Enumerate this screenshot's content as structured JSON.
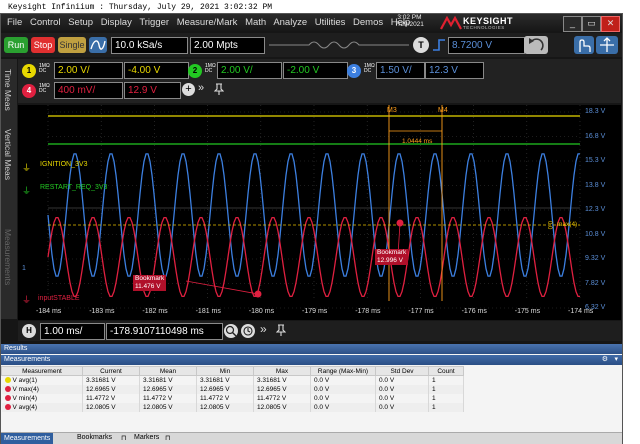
{
  "caption": "Keysight Infiniium : Thursday, July 29, 2021 3:02:32 PM",
  "menu": [
    "File",
    "Control",
    "Setup",
    "Display",
    "Trigger",
    "Measure/Mark",
    "Math",
    "Analyze",
    "Utilities",
    "Demos",
    "Help"
  ],
  "clock": {
    "time": "3:02 PM",
    "date": "7/29/2021"
  },
  "brand": {
    "name": "KEYSIGHT",
    "sub": "TECHNOLOGIES"
  },
  "toolbar": {
    "run": "Run",
    "stop": "Stop",
    "single": "Single",
    "sample_rate": "10.0 kSa/s",
    "memory_depth": "2.00 Mpts",
    "trigger_badge": "T",
    "trigger_level": "8.7200 V"
  },
  "vtabs": {
    "time_meas": "Time Meas",
    "vertical_meas": "Vertical Meas",
    "measurements": "Measurements"
  },
  "channels": {
    "ch1": {
      "num": "1",
      "coupling": "1MΩ",
      "mode": "DC",
      "scale": "2.00 V/",
      "offset": "-4.00 V"
    },
    "ch2": {
      "num": "2",
      "coupling": "1MΩ",
      "mode": "DC",
      "scale": "2.00 V/",
      "offset": "-2.00 V"
    },
    "ch3": {
      "num": "3",
      "coupling": "1MΩ",
      "mode": "DC",
      "scale": "1.50 V/",
      "offset": "12.3 V"
    },
    "ch4": {
      "num": "4",
      "coupling": "1MΩ",
      "mode": "DC",
      "scale": "400 mV/",
      "offset": "12.9 V"
    }
  },
  "labels": {
    "ignition": "IGNITION_3V3",
    "restart": "RESTART_REQ_3V3",
    "input": "inputSTABLE",
    "ground_marker": "1",
    "max_tag": "max(4)",
    "ref_marker": "0.0"
  },
  "markers": {
    "m3": "M3",
    "m4": "M4",
    "delta": "1.0444 ms"
  },
  "bookmarks": [
    {
      "title": "Bookmark",
      "value": "11.476 V"
    },
    {
      "title": "Bookmark",
      "value": "12.996 V"
    }
  ],
  "x_ticks": [
    "-184 ms",
    "-183 ms",
    "-182 ms",
    "-181 ms",
    "-180 ms",
    "-179 ms",
    "-178 ms",
    "-177 ms",
    "-176 ms",
    "-175 ms",
    "-174 ms"
  ],
  "y_ticks": [
    "18.3 V",
    "16.8 V",
    "15.3 V",
    "13.8 V",
    "12.3 V",
    "10.8 V",
    "9.32 V",
    "7.82 V",
    "6.32 V"
  ],
  "timebase": {
    "badge": "H",
    "scale": "1.00 ms/",
    "position": "-178.9107110498 ms"
  },
  "results_title": "Results",
  "measurements_title": "Measurements",
  "columns": [
    "Measurement",
    "Current",
    "Mean",
    "Min",
    "Max",
    "Range (Max-Min)",
    "Std Dev",
    "Count"
  ],
  "rows": [
    {
      "name": "V avg(1)",
      "color": "#e8d800",
      "current": "3.31681 V",
      "mean": "3.31681 V",
      "min": "3.31681 V",
      "max": "3.31681 V",
      "range": "0.0 V",
      "std": "0.0 V",
      "count": "1"
    },
    {
      "name": "V max(4)",
      "color": "#e02040",
      "current": "12.6965 V",
      "mean": "12.6965 V",
      "min": "12.6965 V",
      "max": "12.6965 V",
      "range": "0.0 V",
      "std": "0.0 V",
      "count": "1"
    },
    {
      "name": "V min(4)",
      "color": "#e02040",
      "current": "11.4772 V",
      "mean": "11.4772 V",
      "min": "11.4772 V",
      "max": "11.4772 V",
      "range": "0.0 V",
      "std": "0.0 V",
      "count": "1"
    },
    {
      "name": "V avg(4)",
      "color": "#e02040",
      "current": "12.0805 V",
      "mean": "12.0805 V",
      "min": "12.0805 V",
      "max": "12.0805 V",
      "range": "0.0 V",
      "std": "0.0 V",
      "count": "1"
    }
  ],
  "bottom_tabs": [
    "Measurements",
    "Bookmarks",
    "Markers"
  ],
  "colors": {
    "ch1": "#e8d800",
    "ch2": "#22c822",
    "ch3": "#3c7fe0",
    "ch4": "#e02040",
    "marker": "#ff9f1c"
  }
}
